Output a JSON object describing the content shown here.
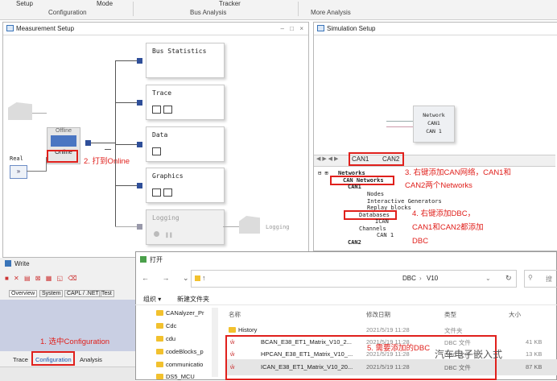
{
  "ribbon": {
    "top_labels": [
      "Setup",
      "Mode",
      "Tracker"
    ],
    "groups": [
      "Configuration",
      "Bus Analysis",
      "More Analysis"
    ]
  },
  "measurement_setup": {
    "title": "Measurement Setup",
    "blocks": [
      "Bus Statistics",
      "Trace",
      "Data",
      "Graphics",
      "Logging"
    ],
    "offline_label": "Offline",
    "online_label": "Online",
    "real_label": "Real",
    "logging_file_label": "Logging"
  },
  "simulation_setup": {
    "title": "Simulation Setup",
    "network_label": "Network",
    "network_lines": [
      "CAN1",
      "CAN 1"
    ],
    "tabs": [
      "CAN1",
      "CAN2"
    ],
    "tree": {
      "networks": "Networks",
      "can_networks": "CAN Networks",
      "can1": "CAN1",
      "nodes": "Nodes",
      "interactive_generators": "Interactive Generators",
      "replay_blocks": "Replay blocks",
      "databases": "Databases",
      "ican": "ICAN",
      "channels": "Channels",
      "channel_can1": "CAN 1",
      "can2": "CAN2"
    }
  },
  "write_window": {
    "title": "Write",
    "tabs": [
      "Overview",
      "System",
      "CAPL / .NET",
      "Test"
    ]
  },
  "bottom_tabs": [
    "Trace",
    "Configuration",
    "Analysis"
  ],
  "dialog": {
    "title": "打开",
    "path": [
      "DBC",
      "V10"
    ],
    "toolbar": [
      "组织 ▾",
      "新建文件夹"
    ],
    "columns": [
      "名称",
      "修改日期",
      "类型",
      "大小"
    ],
    "sidebar": [
      "CANalyzer_Pr",
      "Cdc",
      "cdu",
      "codeBlocks_p",
      "communicatio",
      "DS5_MCU"
    ],
    "files": [
      {
        "name": "History",
        "date": "2021/5/19 11:28",
        "type": "文件夹",
        "size": ""
      },
      {
        "name": "BCAN_E38_ET1_Matrix_V10_2...",
        "date": "2021/5/19 11:28",
        "type": "DBC 文件",
        "size": "41 KB"
      },
      {
        "name": "HPCAN_E38_ET1_Matrix_V10_...",
        "date": "2021/5/19 11:28",
        "type": "DBC 文件",
        "size": "13 KB"
      },
      {
        "name": "ICAN_E38_ET1_Matrix_V10_20...",
        "date": "2021/5/19 11:28",
        "type": "DBC 文件",
        "size": "87 KB"
      }
    ],
    "search_placeholder": "搜"
  },
  "annotations": {
    "a1": "1. 选中Configuration",
    "a2": "2. 打到Online",
    "a3": "3. 右键添加CAN网络，CAN1和",
    "a3b": "CAN2两个Networks",
    "a4": "4. 右键添加DBC，",
    "a4b": "CAN1和CAN2都添加",
    "a4c": "DBC",
    "a5": "5. 需要添加的DBC"
  },
  "watermark": "汽车电子嵌入式"
}
